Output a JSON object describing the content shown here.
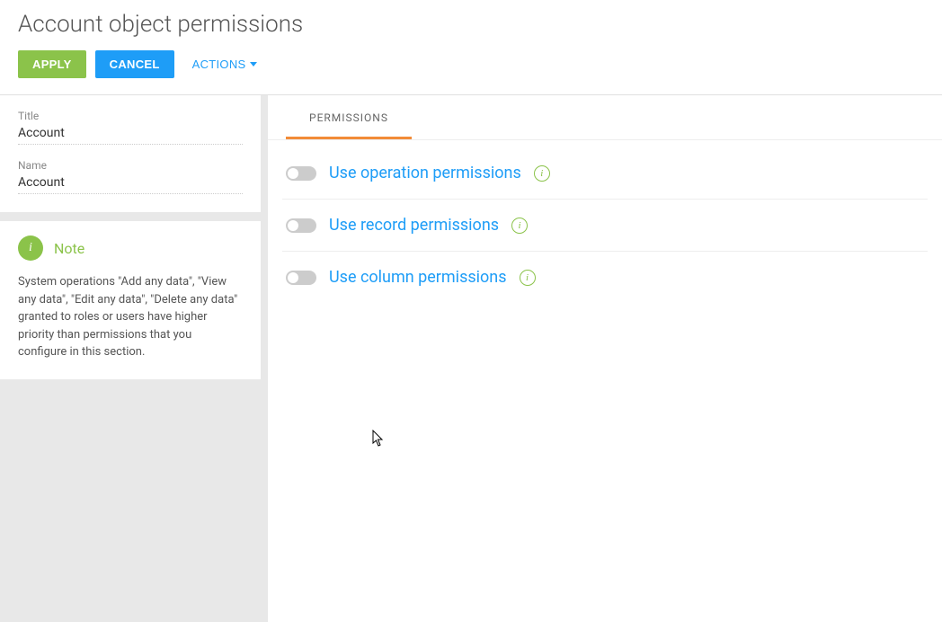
{
  "header": {
    "title": "Account object permissions",
    "apply_label": "APPLY",
    "cancel_label": "CANCEL",
    "actions_label": "ACTIONS"
  },
  "sidebar": {
    "fields": {
      "title_label": "Title",
      "title_value": "Account",
      "name_label": "Name",
      "name_value": "Account"
    },
    "note": {
      "heading": "Note",
      "text": "System operations \"Add any data\", \"View any data\", \"Edit any data\", \"Delete any data\" granted to roles or users have higher priority than permissions that you configure in this section."
    }
  },
  "main": {
    "tab_label": "PERMISSIONS",
    "permissions": [
      {
        "label": "Use operation permissions"
      },
      {
        "label": "Use record permissions"
      },
      {
        "label": "Use column permissions"
      }
    ]
  }
}
